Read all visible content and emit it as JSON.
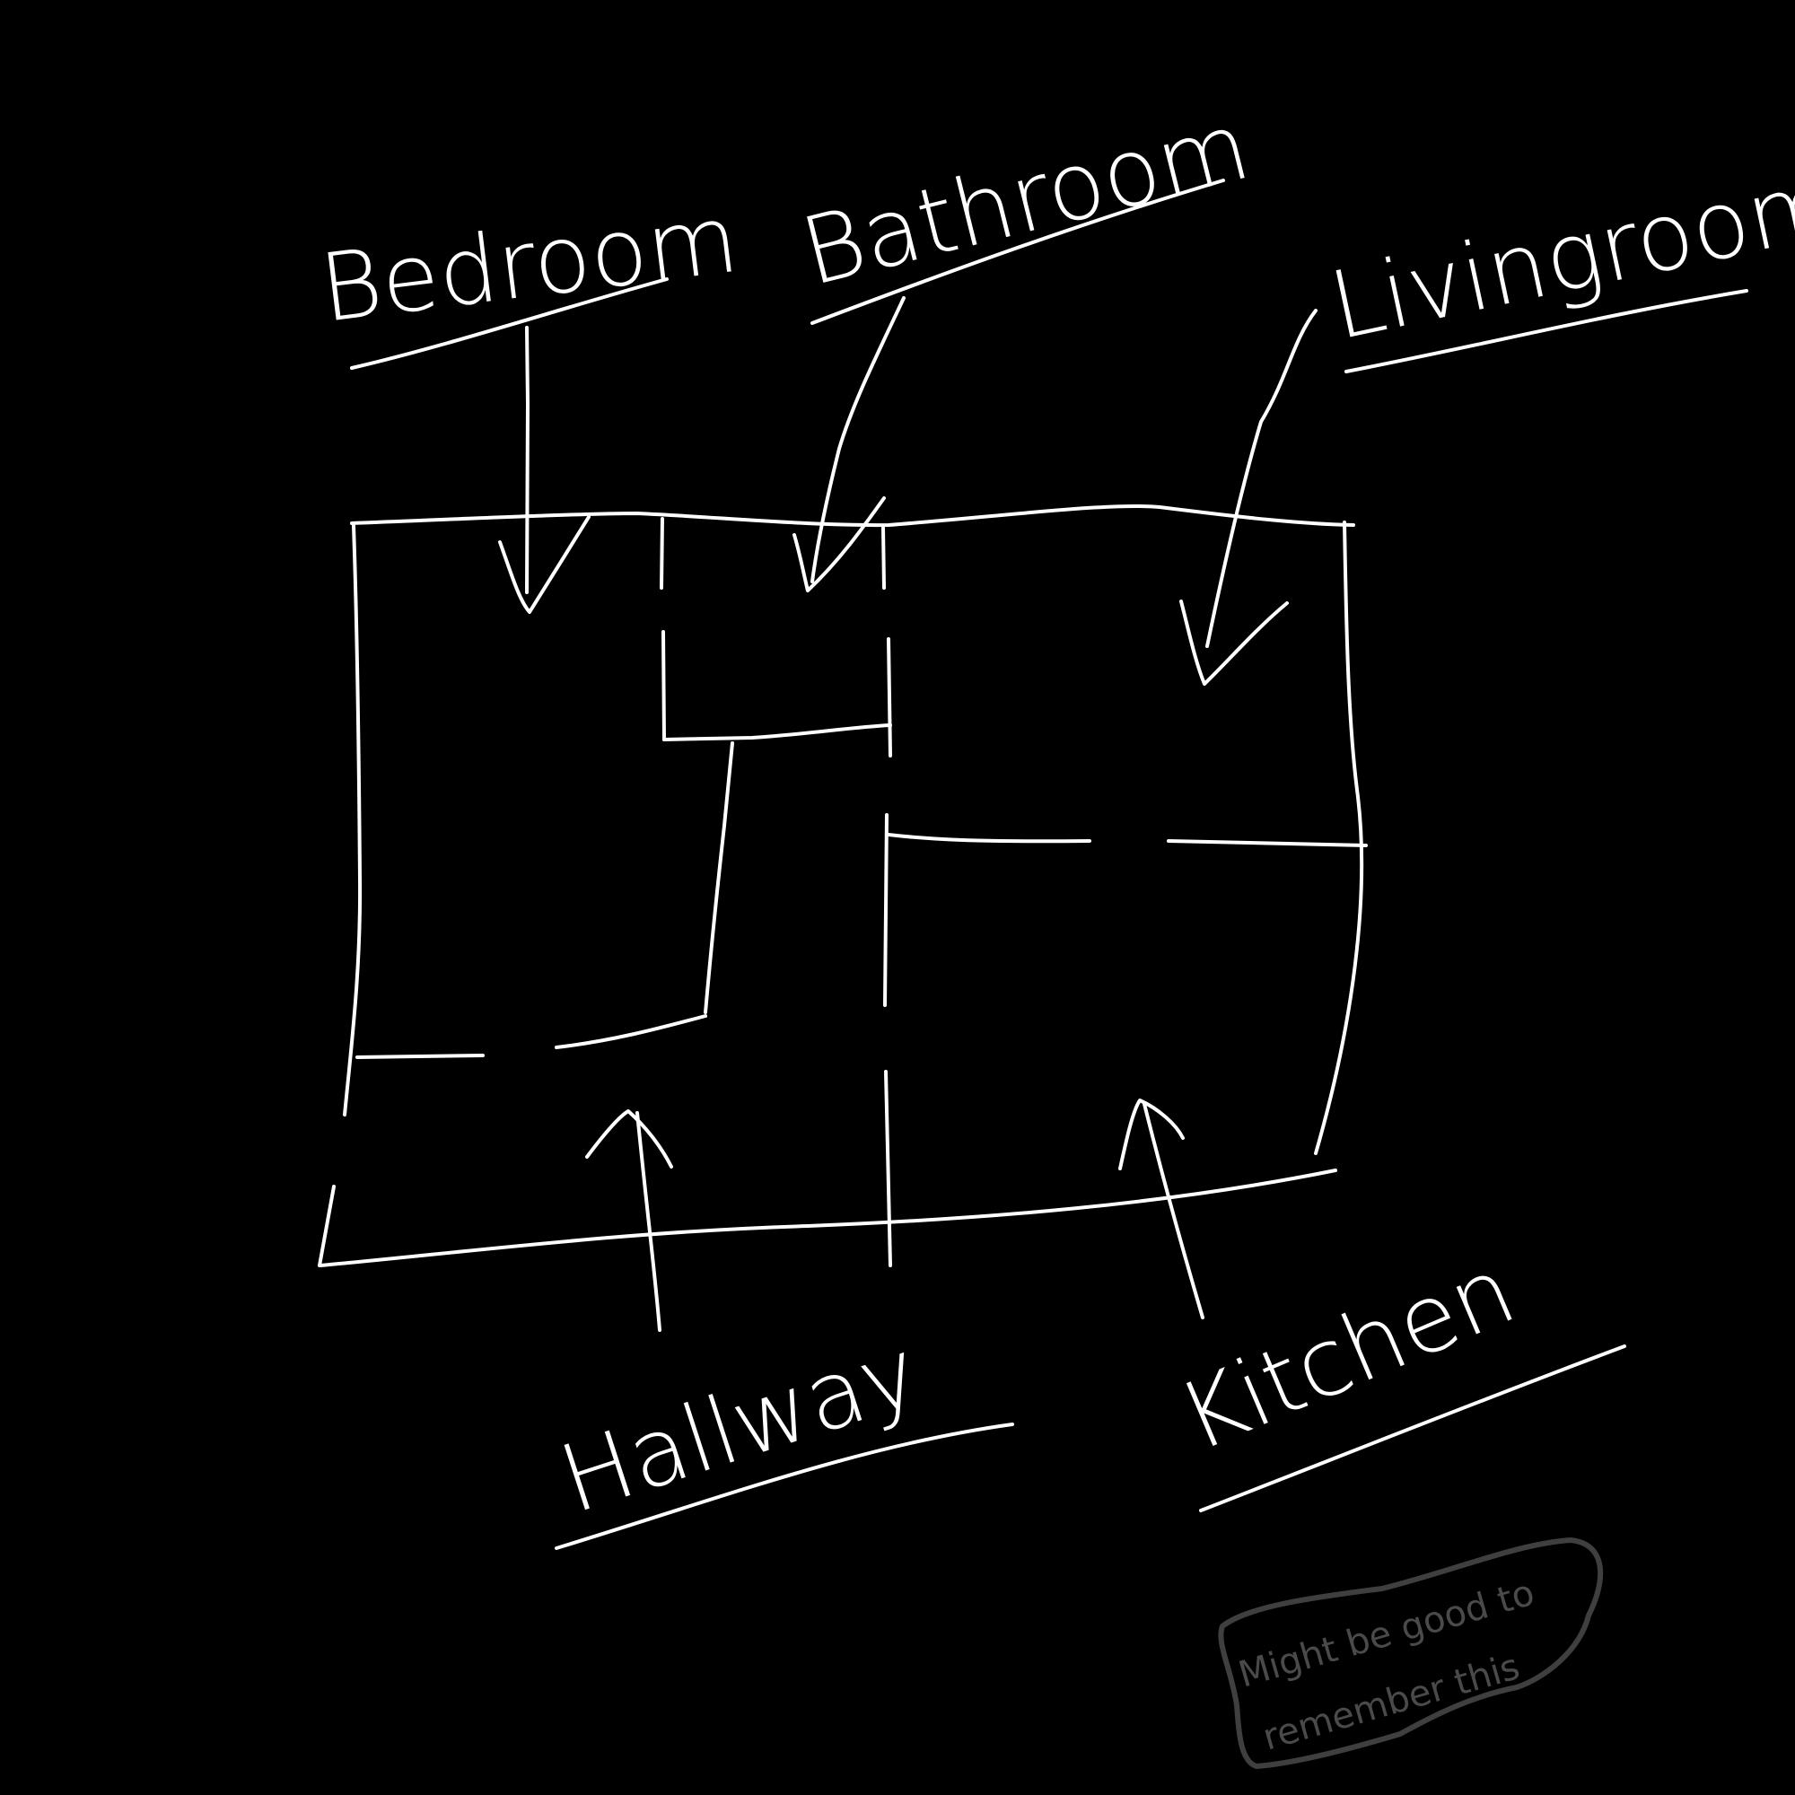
{
  "rooms": {
    "bedroom": "Bedroom",
    "bathroom": "Bathroom",
    "livingroom": "Livingroom",
    "hallway": "Hallway",
    "kitchen": "Kitchen"
  },
  "note": {
    "line1": "Might be good to",
    "line2": "remember this"
  },
  "colors": {
    "background": "#000000",
    "ink": "#ffffff",
    "note_ink": "#4a4a4a"
  }
}
